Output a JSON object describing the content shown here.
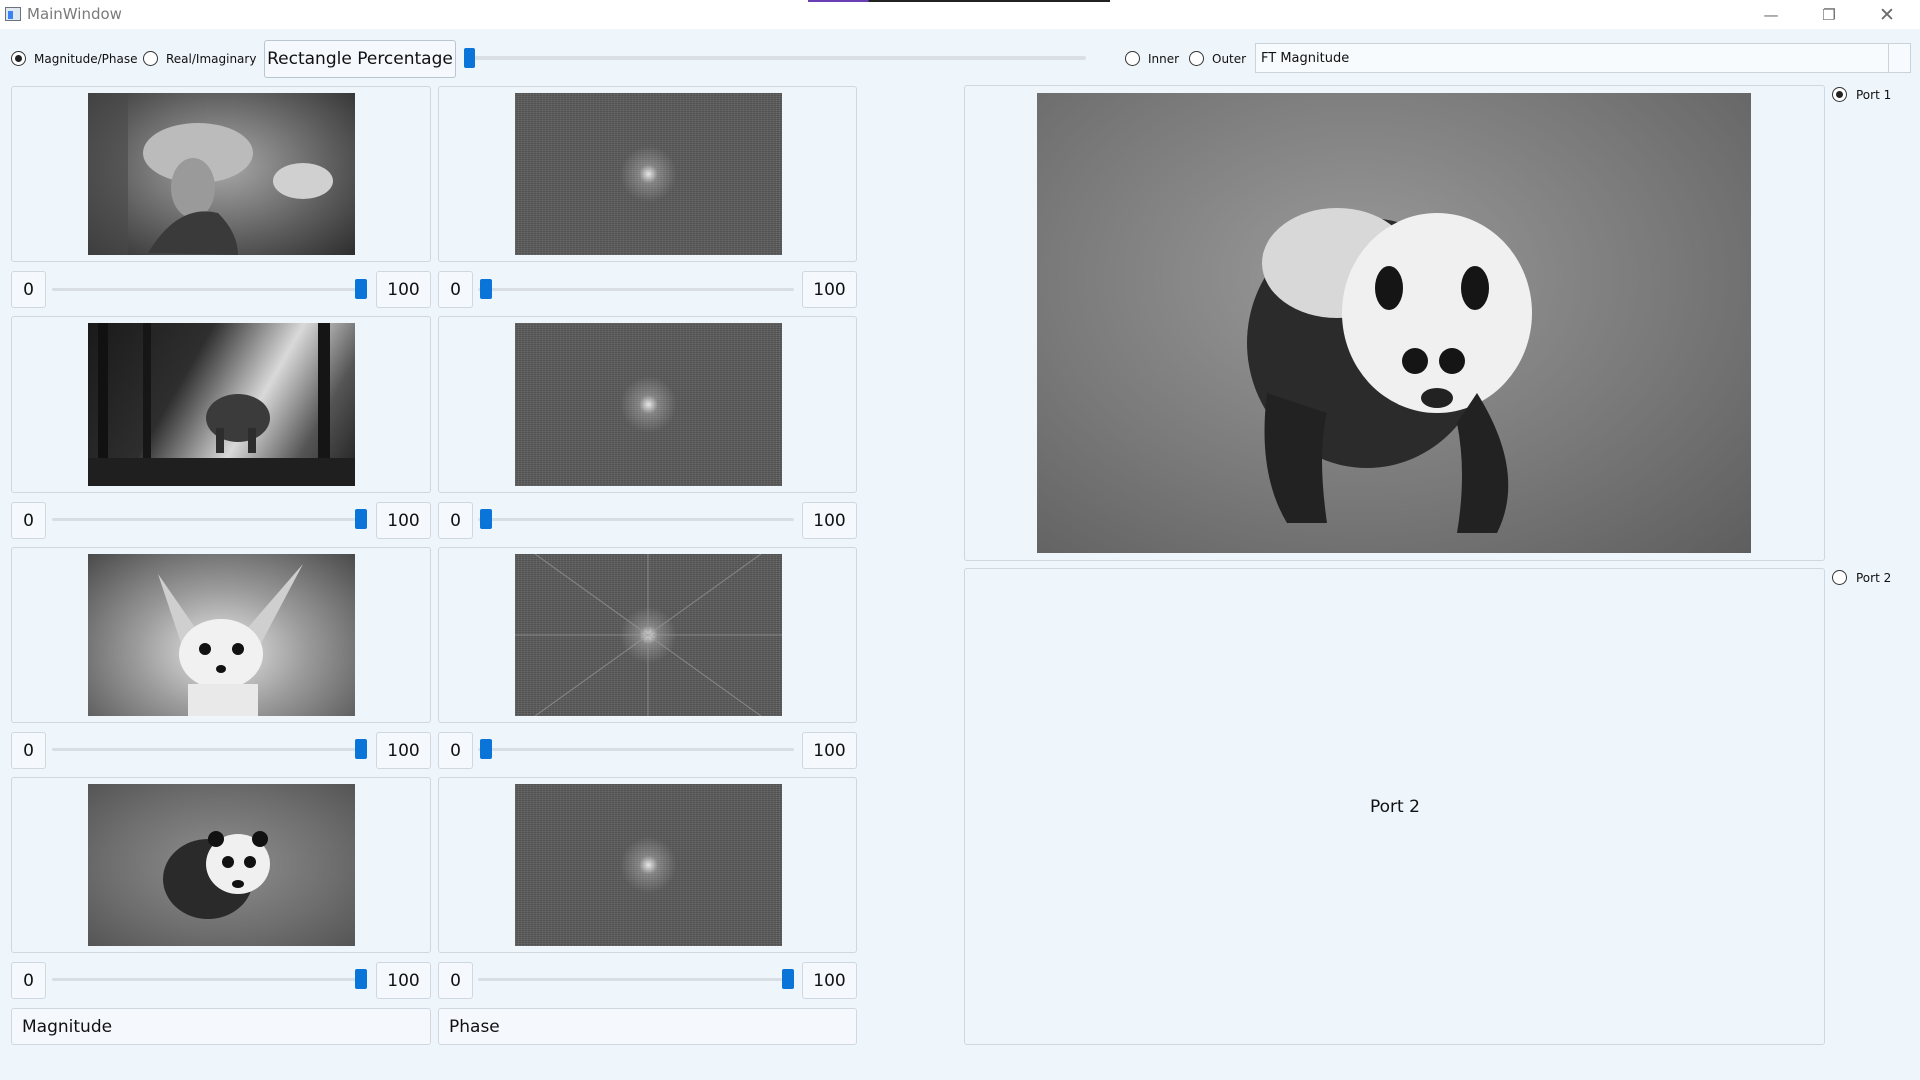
{
  "window": {
    "title": "MainWindow"
  },
  "toolbar": {
    "mode_options": [
      {
        "label": "Magnitude/Phase",
        "selected": true
      },
      {
        "label": "Real/Imaginary",
        "selected": false
      }
    ],
    "rectangle_button": "Rectangle Percentage",
    "rectangle_percentage": 0,
    "region_options": [
      {
        "label": "Inner",
        "selected": false
      },
      {
        "label": "Outer",
        "selected": false
      }
    ],
    "display_select": "FT Magnitude"
  },
  "images": [
    {
      "image_icon": "lena-woman-hat-photo",
      "ft_icon": "ft-magnitude-pattern",
      "min": "0",
      "max": "100",
      "image_weight": 100,
      "ft_weight": 0
    },
    {
      "image_icon": "elephant-forest-photo",
      "ft_icon": "ft-magnitude-pattern",
      "min": "0",
      "max": "100",
      "image_weight": 100,
      "ft_weight": 0
    },
    {
      "image_icon": "fennec-fox-photo",
      "ft_icon": "ft-magnitude-pattern",
      "min": "0",
      "max": "100",
      "image_weight": 100,
      "ft_weight": 0
    },
    {
      "image_icon": "panda-photo",
      "ft_icon": "ft-magnitude-pattern",
      "min": "0",
      "max": "100",
      "image_weight": 100,
      "ft_weight": 100
    }
  ],
  "bottom": {
    "left_value": "Magnitude",
    "right_value": "Phase"
  },
  "output": {
    "ports": [
      {
        "label": "Port 1",
        "selected": true
      },
      {
        "label": "Port 2",
        "selected": false
      }
    ],
    "port1_image_icon": "panda-output-photo",
    "port2_placeholder": "Port 2"
  },
  "colors": {
    "accent": "#0b74d8",
    "background": "#eef5fb"
  }
}
